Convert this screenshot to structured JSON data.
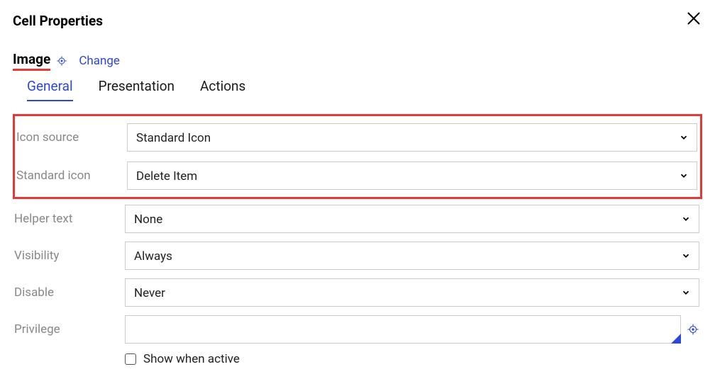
{
  "header": {
    "title": "Cell Properties"
  },
  "subheader": {
    "title": "Image",
    "change_label": "Change"
  },
  "tabs": {
    "general": "General",
    "presentation": "Presentation",
    "actions": "Actions"
  },
  "form": {
    "icon_source": {
      "label": "Icon source",
      "value": "Standard Icon"
    },
    "standard_icon": {
      "label": "Standard icon",
      "value": "Delete Item"
    },
    "helper_text": {
      "label": "Helper text",
      "value": "None"
    },
    "visibility": {
      "label": "Visibility",
      "value": "Always"
    },
    "disable": {
      "label": "Disable",
      "value": "Never"
    },
    "privilege": {
      "label": "Privilege",
      "value": ""
    },
    "show_when_active": {
      "label": "Show when active",
      "checked": false
    }
  }
}
